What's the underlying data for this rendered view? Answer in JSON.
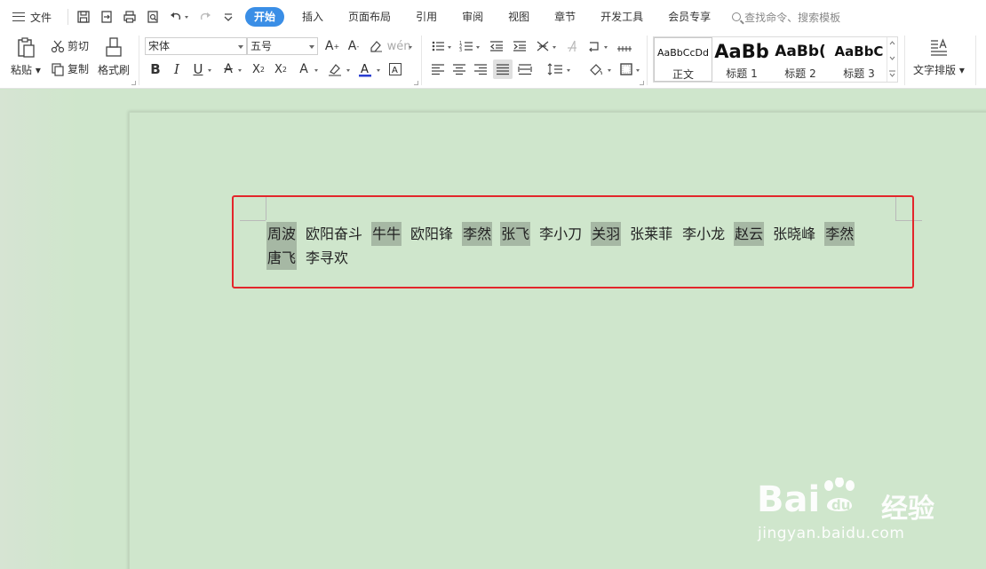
{
  "menubar": {
    "file_label": "文件",
    "tabs": [
      {
        "label": "开始",
        "active": true
      },
      {
        "label": "插入"
      },
      {
        "label": "页面布局"
      },
      {
        "label": "引用"
      },
      {
        "label": "审阅"
      },
      {
        "label": "视图"
      },
      {
        "label": "章节"
      },
      {
        "label": "开发工具"
      },
      {
        "label": "会员专享"
      }
    ],
    "search_placeholder": "查找命令、搜索模板"
  },
  "ribbon": {
    "paste_label": "粘贴",
    "cut_label": "剪切",
    "copy_label": "复制",
    "format_painter_label": "格式刷",
    "font_name": "宋体",
    "font_size": "五号",
    "styles": [
      {
        "preview": "AaBbCcDd",
        "name": "正文"
      },
      {
        "preview": "AaBb",
        "name": "标题 1"
      },
      {
        "preview": "AaBb(",
        "name": "标题 2"
      },
      {
        "preview": "AaBbC",
        "name": "标题 3"
      }
    ],
    "text_layout_label": "文字排版",
    "accent_color": "#3a8ee6",
    "font_color_bar": "#2b3fd1"
  },
  "document": {
    "names": [
      {
        "text": "周波",
        "highlighted": true
      },
      {
        "text": "欧阳奋斗",
        "highlighted": false
      },
      {
        "text": "牛牛",
        "highlighted": true
      },
      {
        "text": "欧阳锋",
        "highlighted": false
      },
      {
        "text": "李然",
        "highlighted": true
      },
      {
        "text": "张飞",
        "highlighted": true
      },
      {
        "text": "李小刀",
        "highlighted": false
      },
      {
        "text": "关羽",
        "highlighted": true
      },
      {
        "text": "张莱菲",
        "highlighted": false
      },
      {
        "text": "李小龙",
        "highlighted": false
      },
      {
        "text": "赵云",
        "highlighted": true
      },
      {
        "text": "张晓峰",
        "highlighted": false
      },
      {
        "text": "李然",
        "highlighted": true
      },
      {
        "text": "唐飞",
        "highlighted": true
      },
      {
        "text": "李寻欢",
        "highlighted": false
      }
    ],
    "highlight_color": "#a6b8a4",
    "selection_box_color": "#e3262b"
  },
  "watermark": {
    "brand": "Bai",
    "brand_suffix": "经验",
    "url": "jingyan.baidu.com"
  }
}
